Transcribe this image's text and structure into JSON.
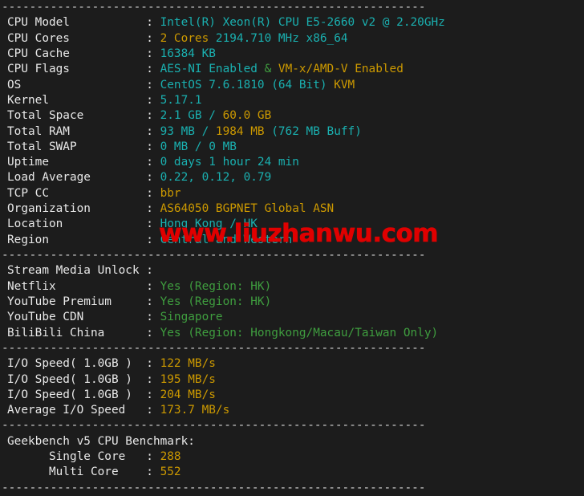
{
  "terminal": {
    "background_color": "#1c1c1c",
    "separator_char": "-",
    "separator_line": "-------------------------------------------------------------",
    "colors": {
      "label": "#e8e8e8",
      "value_primary": "#1ab0b0",
      "value_highlight": "#cc9900",
      "value_stream": "#3f9e3f",
      "watermark": "#e00000"
    }
  },
  "watermark": {
    "text": "www.liuzhanwu.com"
  },
  "sections": [
    {
      "id": "system-info",
      "rows": [
        {
          "label": "CPU Model",
          "segments": [
            {
              "text": "Intel(R) Xeon(R) CPU E5-2660 v2 @ 2.20GHz",
              "color": "cyan"
            }
          ]
        },
        {
          "label": "CPU Cores",
          "segments": [
            {
              "text": "2 Cores ",
              "color": "gold"
            },
            {
              "text": "2194.710 MHz x86_64",
              "color": "cyan"
            }
          ]
        },
        {
          "label": "CPU Cache",
          "segments": [
            {
              "text": "16384 KB",
              "color": "cyan"
            }
          ]
        },
        {
          "label": "CPU Flags",
          "segments": [
            {
              "text": "AES-NI Enabled ",
              "color": "cyan"
            },
            {
              "text": "& ",
              "color": "green"
            },
            {
              "text": "VM-x/AMD-V Enabled",
              "color": "gold"
            }
          ]
        },
        {
          "label": "OS",
          "segments": [
            {
              "text": "CentOS 7.6.1810 (64 Bit) ",
              "color": "cyan"
            },
            {
              "text": "KVM",
              "color": "gold"
            }
          ]
        },
        {
          "label": "Kernel",
          "segments": [
            {
              "text": "5.17.1",
              "color": "cyan"
            }
          ]
        },
        {
          "label": "Total Space",
          "segments": [
            {
              "text": "2.1 GB / ",
              "color": "cyan"
            },
            {
              "text": "60.0 GB",
              "color": "gold"
            }
          ]
        },
        {
          "label": "Total RAM",
          "segments": [
            {
              "text": "93 MB / ",
              "color": "cyan"
            },
            {
              "text": "1984 MB ",
              "color": "gold"
            },
            {
              "text": "(762 MB Buff)",
              "color": "cyan"
            }
          ]
        },
        {
          "label": "Total SWAP",
          "segments": [
            {
              "text": "0 MB / 0 MB",
              "color": "cyan"
            }
          ]
        },
        {
          "label": "Uptime",
          "segments": [
            {
              "text": "0 days 1 hour 24 min",
              "color": "cyan"
            }
          ]
        },
        {
          "label": "Load Average",
          "segments": [
            {
              "text": "0.22, 0.12, 0.79",
              "color": "cyan"
            }
          ]
        },
        {
          "label": "TCP CC",
          "segments": [
            {
              "text": "bbr",
              "color": "gold"
            }
          ]
        },
        {
          "label": "Organization",
          "segments": [
            {
              "text": "AS64050 BGPNET Global ASN",
              "color": "gold"
            }
          ]
        },
        {
          "label": "Location",
          "segments": [
            {
              "text": "Hong Kong / HK",
              "color": "cyan"
            }
          ]
        },
        {
          "label": "Region",
          "segments": [
            {
              "text": "Central and Western",
              "color": "cyan"
            }
          ]
        }
      ]
    },
    {
      "id": "stream-media-unlock",
      "rows": [
        {
          "label": "Stream Media Unlock",
          "segments": []
        },
        {
          "label": "Netflix",
          "segments": [
            {
              "text": "Yes (Region: HK)",
              "color": "green"
            }
          ]
        },
        {
          "label": "YouTube Premium",
          "segments": [
            {
              "text": "Yes (Region: HK)",
              "color": "green"
            }
          ]
        },
        {
          "label": "YouTube CDN",
          "segments": [
            {
              "text": "Singapore",
              "color": "green"
            }
          ]
        },
        {
          "label": "BiliBili China",
          "segments": [
            {
              "text": "Yes (Region: Hongkong/Macau/Taiwan Only)",
              "color": "green"
            }
          ]
        }
      ]
    },
    {
      "id": "io-speed",
      "rows": [
        {
          "label": "I/O Speed( 1.0GB )",
          "segments": [
            {
              "text": "122 MB/s",
              "color": "gold"
            }
          ]
        },
        {
          "label": "I/O Speed( 1.0GB )",
          "segments": [
            {
              "text": "195 MB/s",
              "color": "gold"
            }
          ]
        },
        {
          "label": "I/O Speed( 1.0GB )",
          "segments": [
            {
              "text": "204 MB/s",
              "color": "gold"
            }
          ]
        },
        {
          "label": "Average I/O Speed",
          "segments": [
            {
              "text": "173.7 MB/s",
              "color": "gold"
            }
          ]
        }
      ]
    },
    {
      "id": "geekbench",
      "heading": "Geekbench v5 CPU Benchmark:",
      "rows": [
        {
          "label": "Single Core",
          "indent": 6,
          "segments": [
            {
              "text": "288",
              "color": "gold"
            }
          ]
        },
        {
          "label": "Multi Core",
          "indent": 6,
          "segments": [
            {
              "text": "552",
              "color": "gold"
            }
          ]
        }
      ]
    }
  ]
}
